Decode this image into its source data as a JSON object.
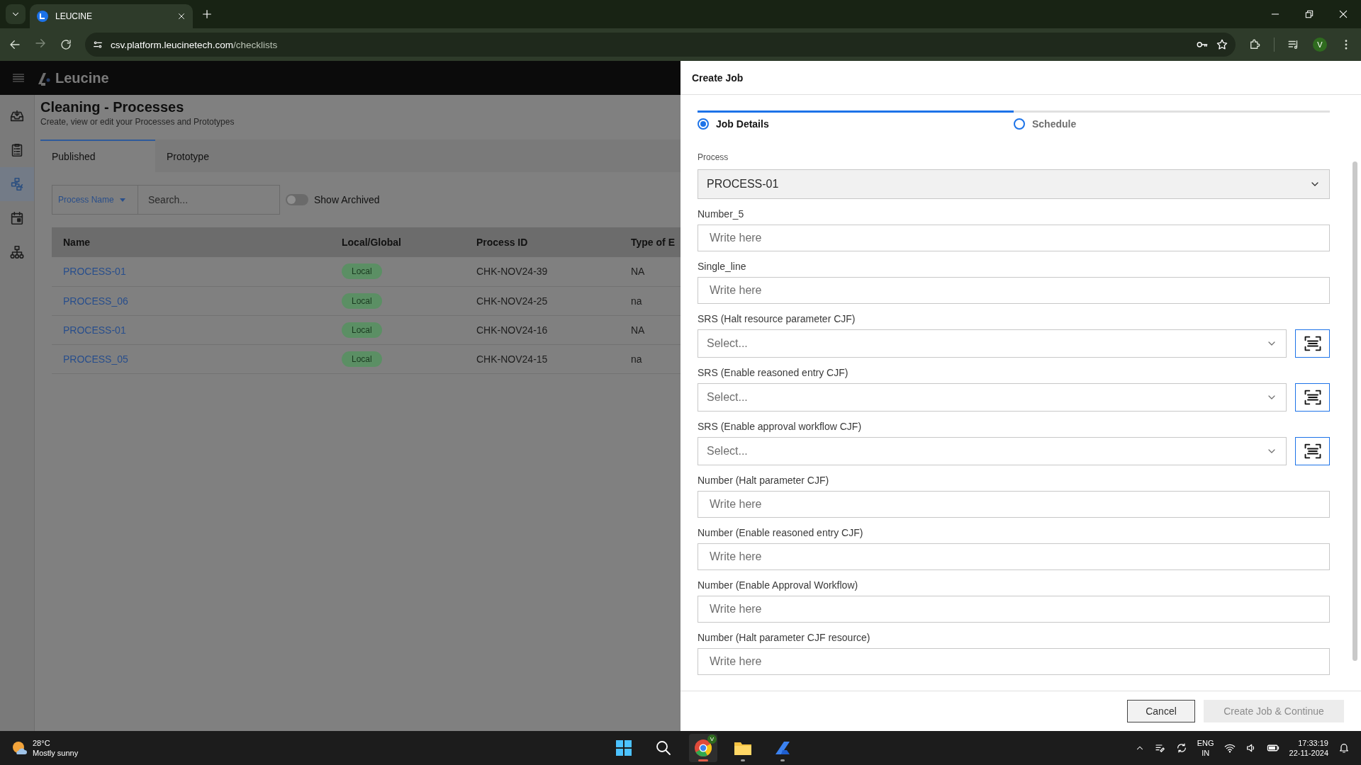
{
  "browser": {
    "tab_title": "LEUCINE",
    "url_host": "csv.platform.leucinetech.com",
    "url_path": "/checklists",
    "avatar": "V"
  },
  "app": {
    "brand": "Leucine",
    "sidebar": {
      "items": [
        {
          "kind": "inbox",
          "selected": false
        },
        {
          "kind": "checklist",
          "selected": false
        },
        {
          "kind": "process",
          "selected": true
        },
        {
          "kind": "calendar",
          "selected": false
        },
        {
          "kind": "hierarchy",
          "selected": false
        }
      ]
    },
    "page_title": "Cleaning - Processes",
    "page_subtitle": "Create, view or edit your Processes and Prototypes",
    "tabs": [
      {
        "label": "Published",
        "selected": true
      },
      {
        "label": "Prototype",
        "selected": false
      }
    ],
    "filter": {
      "field": "Process Name",
      "search_placeholder": "Search...",
      "toggle_label": "Show Archived",
      "on": false
    },
    "table": {
      "columns": [
        "Name",
        "Local/Global",
        "Process ID",
        "Type of E"
      ],
      "rows": [
        {
          "name": "PROCESS-01",
          "scope": "Local",
          "process_id": "CHK-NOV24-39",
          "type": "NA"
        },
        {
          "name": "PROCESS_06",
          "scope": "Local",
          "process_id": "CHK-NOV24-25",
          "type": "na"
        },
        {
          "name": "PROCESS-01",
          "scope": "Local",
          "process_id": "CHK-NOV24-16",
          "type": "NA"
        },
        {
          "name": "PROCESS_05",
          "scope": "Local",
          "process_id": "CHK-NOV24-15",
          "type": "na"
        }
      ]
    }
  },
  "dialog": {
    "title": "Create Job",
    "steps": [
      {
        "label": "Job Details",
        "selected": true
      },
      {
        "label": "Schedule",
        "selected": false
      }
    ],
    "fields": [
      {
        "kind": "select",
        "label": "Process",
        "value": "PROCESS-01",
        "disabled": true,
        "scan": false
      },
      {
        "kind": "input",
        "label": "Number_5",
        "placeholder": "Write here"
      },
      {
        "kind": "input",
        "label": "Single_line",
        "placeholder": "Write here"
      },
      {
        "kind": "select",
        "label": "SRS (Halt resource parameter CJF)",
        "placeholder": "Select...",
        "disabled": false,
        "scan": true
      },
      {
        "kind": "select",
        "label": "SRS (Enable reasoned entry CJF)",
        "placeholder": "Select...",
        "disabled": false,
        "scan": true
      },
      {
        "kind": "select",
        "label": "SRS (Enable approval workflow CJF)",
        "placeholder": "Select...",
        "disabled": false,
        "scan": true
      },
      {
        "kind": "input",
        "label": "Number (Halt parameter CJF)",
        "placeholder": "Write here"
      },
      {
        "kind": "input",
        "label": "Number (Enable reasoned entry CJF)",
        "placeholder": "Write here"
      },
      {
        "kind": "input",
        "label": "Number (Enable Approval Workflow)",
        "placeholder": "Write here"
      },
      {
        "kind": "input",
        "label": "Number (Halt parameter CJF resource)",
        "placeholder": "Write here"
      }
    ],
    "buttons": [
      {
        "label": "Cancel",
        "disabled": false
      },
      {
        "label": "Create Job & Continue",
        "disabled": true
      }
    ]
  },
  "taskbar": {
    "temperature": "28°C",
    "weather": "Mostly sunny",
    "apps": [
      {
        "kind": "start",
        "running": false
      },
      {
        "kind": "search",
        "running": false
      },
      {
        "kind": "browser",
        "running": true,
        "badge": "V"
      },
      {
        "kind": "folder",
        "running": true
      },
      {
        "kind": "editor",
        "running": true
      }
    ],
    "language": "ENG",
    "region": "IN",
    "time": "17:33:19",
    "date": "22-11-2024"
  }
}
